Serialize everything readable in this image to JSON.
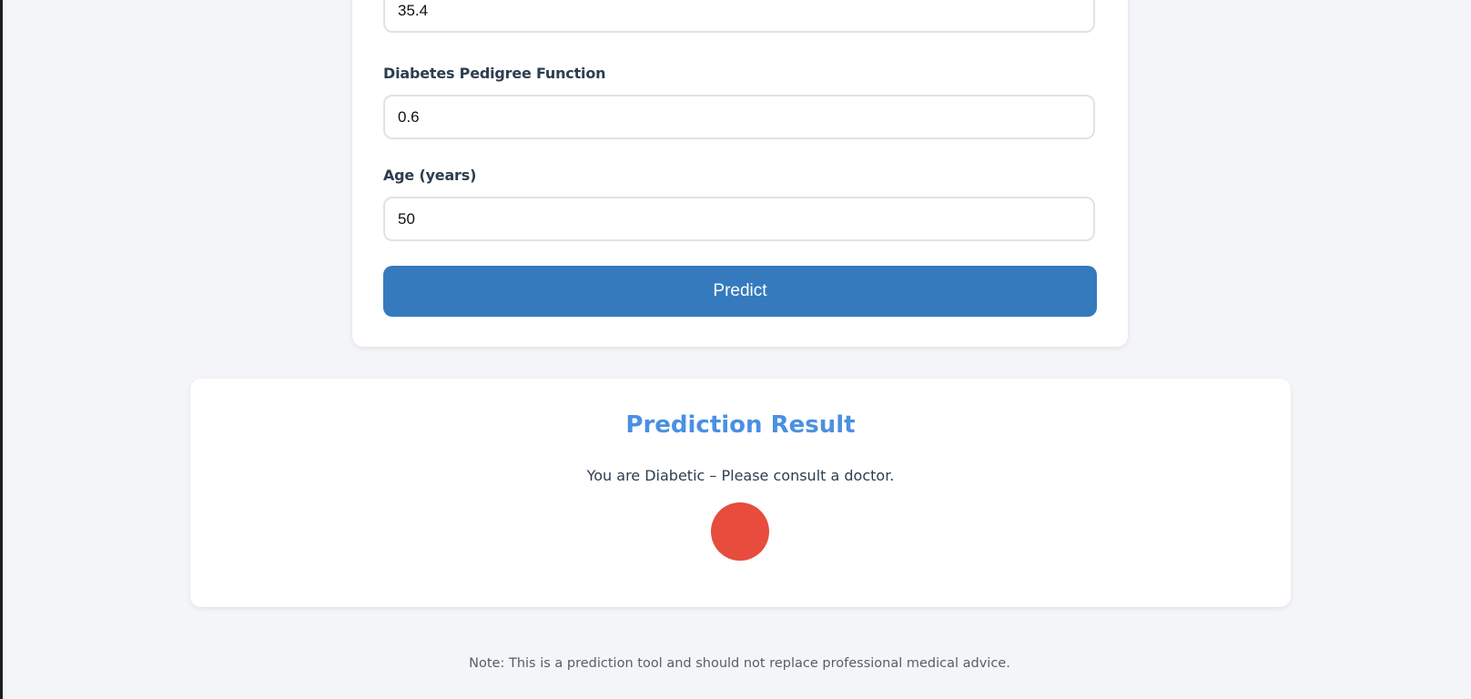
{
  "form": {
    "fields": [
      {
        "label": "",
        "value": "35.4"
      },
      {
        "label": "Diabetes Pedigree Function",
        "value": "0.6"
      },
      {
        "label": "Age (years)",
        "value": "50"
      }
    ],
    "predict_label": "Predict"
  },
  "result": {
    "title": "Prediction Result",
    "message": "You are Diabetic – Please consult a doctor.",
    "indicator_color": "#e74c3c"
  },
  "footer": {
    "note": "Note: This is a prediction tool and should not replace professional medical advice."
  },
  "colors": {
    "accent": "#4a90e2",
    "button": "#357abd",
    "alert": "#e74c3c",
    "background": "#f4f5f8"
  }
}
